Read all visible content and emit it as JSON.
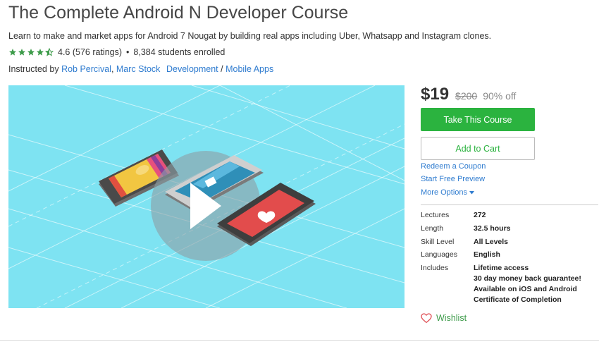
{
  "course": {
    "title": "The Complete Android N Developer Course",
    "subtitle": "Learn to make and market apps for Android 7 Nougat by building real apps including Uber, Whatsapp and Instagram clones.",
    "rating_value": 4.6,
    "rating_text": "4.6 (576 ratings)",
    "enrolled_text": "8,384 students enrolled",
    "instructed_by_label": "Instructed by",
    "instructors": [
      "Rob Percival",
      "Marc Stock"
    ],
    "category": "Development",
    "subcategory": "Mobile Apps",
    "breadcrumb_separator": "/",
    "dot_separator": "•"
  },
  "purchase": {
    "price": "$19",
    "original_price": "$200",
    "discount": "90% off",
    "take_course_label": "Take This Course",
    "add_to_cart_label": "Add to Cart",
    "redeem_coupon_label": "Redeem a Coupon",
    "free_preview_label": "Start Free Preview",
    "more_options_label": "More Options"
  },
  "details": {
    "lectures_label": "Lectures",
    "lectures_value": "272",
    "length_label": "Length",
    "length_value": "32.5 hours",
    "skill_label": "Skill Level",
    "skill_value": "All Levels",
    "languages_label": "Languages",
    "languages_value": "English",
    "includes_label": "Includes",
    "includes": [
      "Lifetime access",
      "30 day money back guarantee!",
      "Available on iOS and Android",
      "Certificate of Completion"
    ]
  },
  "wishlist_label": "Wishlist",
  "colors": {
    "accent_green": "#2bb33f",
    "link_blue": "#2e7bcf",
    "star_green": "#3d9b4a",
    "video_bg": "#7ee3f2",
    "wishlist_heart": "#e0545a"
  },
  "icons": {
    "star": "star-icon",
    "play": "play-icon",
    "heart": "heart-icon",
    "caret": "caret-down-icon"
  }
}
